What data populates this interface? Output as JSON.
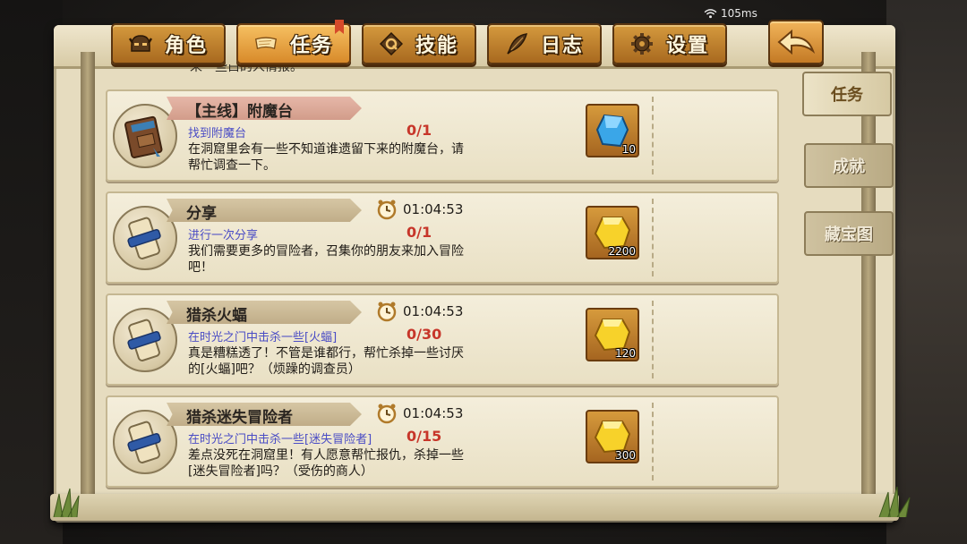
{
  "status": {
    "network": "105ms"
  },
  "tabs": [
    {
      "label": "角色",
      "icon": "helmet-icon",
      "active": false
    },
    {
      "label": "任务",
      "icon": "scroll-icon",
      "active": true
    },
    {
      "label": "技能",
      "icon": "skill-rune-icon",
      "active": false
    },
    {
      "label": "日志",
      "icon": "quill-icon",
      "active": false
    },
    {
      "label": "设置",
      "icon": "gear-icon",
      "active": false
    }
  ],
  "back_button": {
    "icon": "back-arrow-icon"
  },
  "side_tabs": [
    {
      "label": "任务",
      "active": true
    },
    {
      "label": "成就",
      "active": false
    },
    {
      "label": "藏宝图",
      "active": false
    }
  ],
  "list": {
    "clipped_text": "来一些白的人情报。",
    "quests": [
      {
        "title": "【主线】附魔台",
        "main": true,
        "timer": "",
        "objective": "找到附魔台",
        "progress": "0/1",
        "description": "在洞窟里会有一些不知道谁遗留下来的附魔台，请帮忙调查一下。",
        "portrait": "book-icon",
        "reward": {
          "icon": "blue-crystal-icon",
          "count": "10"
        }
      },
      {
        "title": "分享",
        "main": false,
        "timer": "01:04:53",
        "objective": "进行一次分享",
        "progress": "0/1",
        "description": "我们需要更多的冒险者，召集你的朋友来加入冒险吧！",
        "portrait": "scroll-icon",
        "reward": {
          "icon": "gold-coin-icon",
          "count": "2200"
        }
      },
      {
        "title": "猎杀火蝠",
        "main": false,
        "timer": "01:04:53",
        "objective": "在时光之门中击杀一些[火蝠]",
        "progress": "0/30",
        "description": "真是糟糕透了！不管是谁都行，帮忙杀掉一些讨厌的[火蝠]吧？（烦躁的调查员）",
        "portrait": "scroll-icon",
        "reward": {
          "icon": "gold-coin-icon",
          "count": "120"
        }
      },
      {
        "title": "猎杀迷失冒险者",
        "main": false,
        "timer": "01:04:53",
        "objective": "在时光之门中击杀一些[迷失冒险者]",
        "progress": "0/15",
        "description": "差点没死在洞窟里！有人愿意帮忙报仇，杀掉一些[迷失冒险者]吗？（受伤的商人）",
        "portrait": "scroll-icon",
        "reward": {
          "icon": "gold-coin-icon",
          "count": "300"
        }
      }
    ]
  },
  "colors": {
    "tab_orange": "#d59a3e",
    "progress_red": "#c7362a",
    "objective_blue": "#4a4cc5",
    "card_bg": "#f4eedb"
  }
}
